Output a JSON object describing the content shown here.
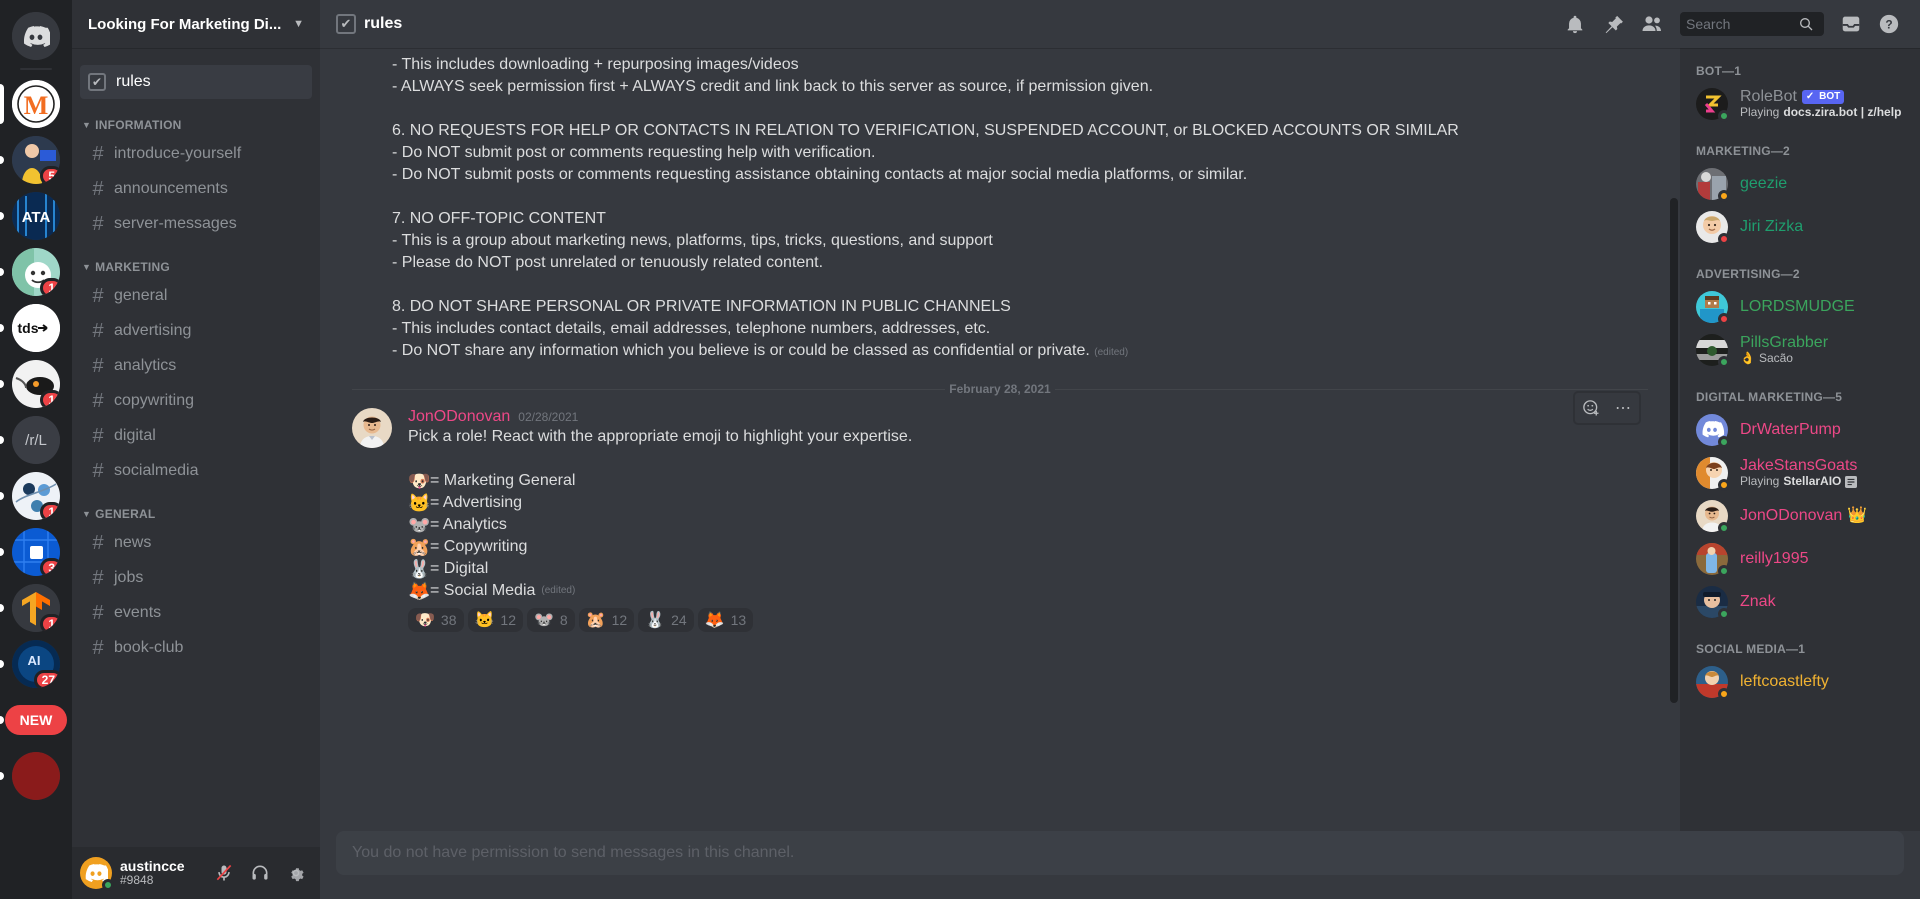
{
  "rail": {
    "home_icon": "discord-home-icon",
    "servers": [
      {
        "name": "marketing-dojo",
        "label": "M",
        "badge": null,
        "indicator": "none"
      },
      {
        "name": "creator-server",
        "label": "",
        "badge": "5",
        "indicator": "dot"
      },
      {
        "name": "ata-server",
        "label": "ATA",
        "badge": null,
        "indicator": "dot"
      },
      {
        "name": "reddit-server",
        "label": "",
        "badge": "1",
        "indicator": "dot"
      },
      {
        "name": "tds-server",
        "label": "tds",
        "badge": null,
        "indicator": "dot"
      },
      {
        "name": "koi-server",
        "label": "",
        "badge": "1",
        "indicator": "dot"
      },
      {
        "name": "r-l-server",
        "label": "/r/L",
        "badge": null,
        "indicator": "dot"
      },
      {
        "name": "bio-server",
        "label": "",
        "badge": "1",
        "indicator": "dot"
      },
      {
        "name": "chip-server",
        "label": "",
        "badge": "3",
        "indicator": "dot"
      },
      {
        "name": "tensorflow-server",
        "label": "",
        "badge": "1",
        "indicator": "dot"
      },
      {
        "name": "ai-server",
        "label": "AI",
        "badge": "27",
        "indicator": "dot"
      },
      {
        "name": "new-server",
        "label": "NEW",
        "badge": null,
        "indicator": "dot"
      }
    ]
  },
  "sidebar": {
    "guild_name": "Looking For Marketing Di...",
    "rules_channel": "rules",
    "categories": [
      {
        "name": "INFORMATION",
        "channels": [
          "introduce-yourself",
          "announcements",
          "server-messages"
        ]
      },
      {
        "name": "MARKETING",
        "channels": [
          "general",
          "advertising",
          "analytics",
          "copywriting",
          "digital",
          "socialmedia"
        ]
      },
      {
        "name": "GENERAL",
        "channels": [
          "news",
          "jobs",
          "events",
          "book-club"
        ]
      }
    ],
    "user": {
      "name": "austincce",
      "tag": "#9848",
      "mic_icon": "mic-muted-icon",
      "headphone_icon": "headphones-icon",
      "settings_icon": "gear-icon"
    }
  },
  "topbar": {
    "channel_name": "rules",
    "channel_icon": "rules-checkbox-icon",
    "icons": [
      "bell-icon",
      "pin-icon",
      "members-icon",
      "inbox-icon",
      "help-icon"
    ]
  },
  "search": {
    "placeholder": "Search",
    "value": "",
    "icon": "search-icon"
  },
  "rules_message": {
    "lines": [
      "- This includes downloading + repurposing images/videos",
      "- ALWAYS seek permission first + ALWAYS credit and link back to this server as source, if permission given.",
      "",
      "6. NO REQUESTS FOR HELP OR CONTACTS IN RELATION TO VERIFICATION, SUSPENDED ACCOUNT, or BLOCKED ACCOUNTS OR SIMILAR",
      "- Do NOT submit post or comments requesting help with verification.",
      "- Do NOT submit posts or comments requesting assistance obtaining contacts at major social media platforms, or similar.",
      "",
      "7. NO OFF-TOPIC CONTENT",
      "- This is a group about marketing news, platforms, tips, tricks, questions, and support",
      "- Please do NOT post unrelated or tenuously related content.",
      "",
      "8. DO NOT SHARE PERSONAL OR PRIVATE INFORMATION IN PUBLIC CHANNELS",
      "- This includes contact details, email addresses, telephone numbers, addresses, etc.",
      "- Do NOT share any information which you believe is or could be classed as confidential or private."
    ],
    "edited_label": "(edited)"
  },
  "date_divider": "February 28, 2021",
  "role_message": {
    "author": "JonODonovan",
    "author_color": "#ed4887",
    "timestamp": "02/28/2021",
    "text": "Pick a role! React with the appropriate emoji to highlight your expertise.",
    "roles": [
      {
        "emoji": "🐶",
        "label": "= Marketing General"
      },
      {
        "emoji": "🐱",
        "label": "= Advertising"
      },
      {
        "emoji": "🐭",
        "label": "= Analytics"
      },
      {
        "emoji": "🐹",
        "label": "= Copywriting"
      },
      {
        "emoji": "🐰",
        "label": "= Digital"
      },
      {
        "emoji": "🦊",
        "label": "= Social Media"
      }
    ],
    "edited_label": "(edited)",
    "reactions": [
      {
        "emoji": "🐶",
        "count": "38"
      },
      {
        "emoji": "🐱",
        "count": "12"
      },
      {
        "emoji": "🐭",
        "count": "8"
      },
      {
        "emoji": "🐹",
        "count": "12"
      },
      {
        "emoji": "🐰",
        "count": "24"
      },
      {
        "emoji": "🦊",
        "count": "13"
      }
    ],
    "toolbar": {
      "add_reaction": "add-reaction-icon",
      "more": "more-options-icon"
    }
  },
  "composer": {
    "placeholder": "You do not have permission to send messages in this channel."
  },
  "members": {
    "groups": [
      {
        "title": "BOT—1",
        "people": [
          {
            "name": "RoleBot",
            "color": "#8e9297",
            "status": "online",
            "bot": true,
            "bot_label": "BOT",
            "activity_prefix": "Playing",
            "activity": "docs.zira.bot | z/help",
            "avatar": "zira"
          }
        ]
      },
      {
        "title": "MARKETING—2",
        "people": [
          {
            "name": "geezie",
            "color": "#1f9e6e",
            "status": "idle",
            "bot": false,
            "avatar": "geezie"
          },
          {
            "name": "Jiri Zizka",
            "color": "#1f9e6e",
            "status": "dnd",
            "bot": false,
            "avatar": "jiri"
          }
        ]
      },
      {
        "title": "ADVERTISING—2",
        "people": [
          {
            "name": "LORDSMUDGE",
            "color": "#3ba55d",
            "status": "dnd",
            "bot": false,
            "avatar": "lord"
          },
          {
            "name": "PillsGrabber",
            "color": "#3ba55d",
            "status": "online",
            "bot": false,
            "custom_emoji": "👌",
            "custom_status": "Sacão",
            "avatar": "pills"
          }
        ]
      },
      {
        "title": "DIGITAL MARKETING—5",
        "people": [
          {
            "name": "DrWaterPump",
            "color": "#ed4887",
            "status": "online",
            "bot": false,
            "avatar": "discord"
          },
          {
            "name": "JakeStansGoats",
            "color": "#ed4887",
            "status": "idle",
            "bot": false,
            "activity_prefix": "Playing",
            "activity": "StellarAIO",
            "activity_icon": "game-icon",
            "avatar": "jake"
          },
          {
            "name": "JonODonovan",
            "color": "#ed4887",
            "status": "online",
            "bot": false,
            "crown": "👑",
            "avatar": "jon"
          },
          {
            "name": "reilly1995",
            "color": "#ed4887",
            "status": "online",
            "bot": false,
            "avatar": "reilly"
          },
          {
            "name": "Znak",
            "color": "#ed4887",
            "status": "online",
            "bot": false,
            "avatar": "znak"
          }
        ]
      },
      {
        "title": "SOCIAL MEDIA—1",
        "people": [
          {
            "name": "leftcoastlefty",
            "color": "#f0b232",
            "status": "idle",
            "bot": false,
            "avatar": "left"
          }
        ]
      }
    ]
  }
}
